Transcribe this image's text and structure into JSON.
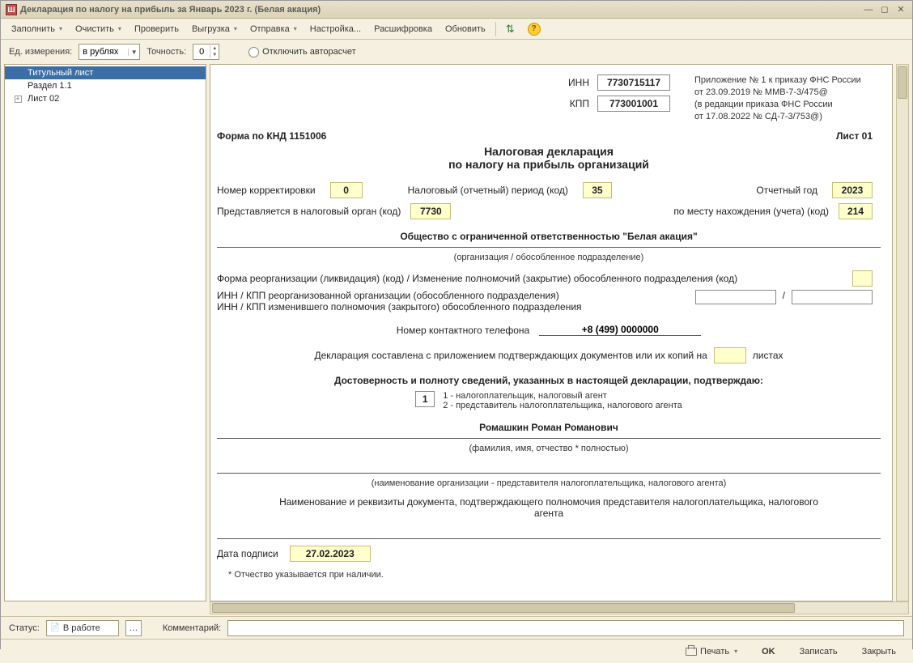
{
  "window": {
    "title": "Декларация по налогу на прибыль за Январь 2023 г. (Белая акация)"
  },
  "toolbar": {
    "fill": "Заполнить",
    "clear": "Очистить",
    "check": "Проверить",
    "export": "Выгрузка",
    "send": "Отправка",
    "settings": "Настройка...",
    "decode": "Расшифровка",
    "refresh": "Обновить"
  },
  "options": {
    "unit_label": "Ед. измерения:",
    "unit_value": "в рублях",
    "precision_label": "Точность:",
    "precision_value": "0",
    "autocalc_label": "Отключить авторасчет"
  },
  "tree": {
    "items": [
      {
        "label": "Титульный лист"
      },
      {
        "label": "Раздел 1.1"
      },
      {
        "label": "Лист 02"
      }
    ]
  },
  "doc": {
    "inn_label": "ИНН",
    "inn_value": "7730715117",
    "kpp_label": "КПП",
    "kpp_value": "773001001",
    "order_line1": "Приложение № 1 к приказу ФНС России",
    "order_line2": "от 23.09.2019 № ММВ-7-3/475@",
    "order_line3": "(в редакции приказа ФНС России",
    "order_line4": "от 17.08.2022 № СД-7-3/753@)",
    "form_code_label": "Форма по КНД 1151006",
    "sheet_label": "Лист 01",
    "title1": "Налоговая декларация",
    "title2": "по налогу на прибыль организаций",
    "corr_label": "Номер корректировки",
    "corr_value": "0",
    "period_label": "Налоговый (отчетный) период (код)",
    "period_value": "35",
    "year_label": "Отчетный год",
    "year_value": "2023",
    "authority_label": "Представляется в налоговый орган (код)",
    "authority_value": "7730",
    "location_label": "по месту нахождения (учета) (код)",
    "location_value": "214",
    "org_name": "Общество с ограниченной ответственностью \"Белая акация\"",
    "org_sub": "(организация / обособленное подразделение)",
    "reorg_label": "Форма реорганизации (ликвидация) (код) / Изменение полномочий (закрытие) обособленного подразделения (код)",
    "reorg_inn_label1": "ИНН / КПП реорганизованной организации (обособленного подразделения)",
    "reorg_inn_label2": "ИНН / КПП изменившего полномочия (закрытого) обособленного подразделения",
    "phone_label": "Номер контактного телефона",
    "phone_value": "+8 (499) 0000000",
    "attach_label_pre": "Декларация составлена с приложением подтверждающих документов или их копий на",
    "attach_label_post": "листах",
    "confirm_title": "Достоверность и полноту сведений, указанных в настоящей декларации, подтверждаю:",
    "confirm_code": "1",
    "confirm_opt1": "1 - налогоплательщик, налоговый агент",
    "confirm_opt2": "2 - представитель налогоплательщика, налогового агента",
    "signer_name": "Ромашкин Роман Романович",
    "signer_sub": "(фамилия, имя, отчество *  полностью)",
    "rep_org_sub": "(наименование организации - представителя налогоплательщика, налогового агента)",
    "rep_doc_label": "Наименование и реквизиты документа, подтверждающего полномочия представителя налогоплательщика, налогового агента",
    "sign_date_label": "Дата подписи",
    "sign_date_value": "27.02.2023",
    "footnote": "* Отчество указывается при наличии."
  },
  "status": {
    "label": "Статус:",
    "value": "В работе",
    "comment_label": "Комментарий:",
    "comment_value": ""
  },
  "footer": {
    "print": "Печать",
    "ok": "OK",
    "save": "Записать",
    "close": "Закрыть"
  }
}
